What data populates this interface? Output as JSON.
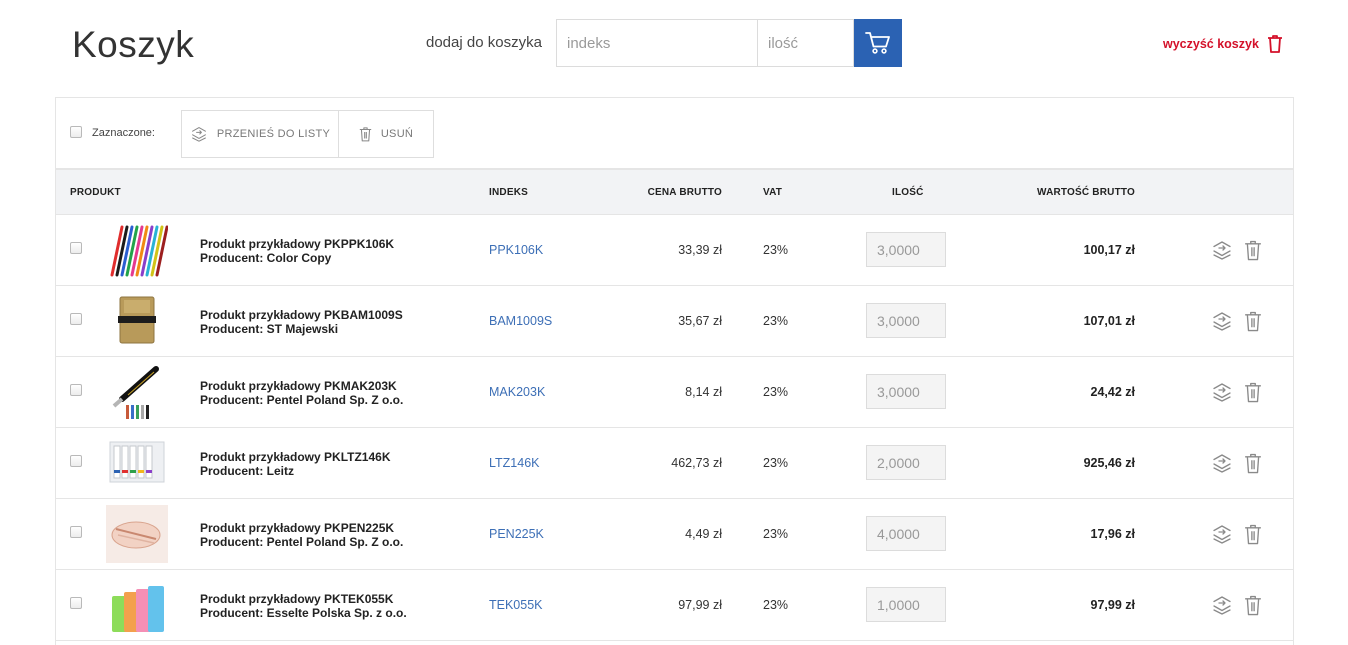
{
  "page": {
    "title": "Koszyk"
  },
  "add_to_cart": {
    "label": "dodaj do koszyka",
    "index_placeholder": "indeks",
    "qty_placeholder": "ilość",
    "button_icon": "cart-icon"
  },
  "clear_cart": {
    "label": "wyczyść koszyk",
    "icon": "trash-icon",
    "color": "#d4112a"
  },
  "bulk": {
    "selected_label": "Zaznaczone:",
    "move_label": "PRZENIEŚ DO LISTY",
    "move_icon": "move-to-list-icon",
    "delete_label": "USUŃ",
    "delete_icon": "trash-icon"
  },
  "columns": {
    "product": "PRODUKT",
    "index": "INDEKS",
    "price": "CENA BRUTTO",
    "vat": "VAT",
    "qty": "ILOŚĆ",
    "value": "WARTOŚĆ BRUTTO"
  },
  "colors": {
    "accent": "#2b62b3",
    "danger": "#d4112a",
    "link": "#3d6fb6"
  },
  "items": [
    {
      "name": "Produkt przykładowy PKPPK106K",
      "producer": "Producent: Color Copy",
      "index": "PPK106K",
      "price": "33,39 zł",
      "vat": "23%",
      "qty": "3,0000",
      "value": "100,17 zł",
      "thumb": "pens"
    },
    {
      "name": "Produkt przykładowy PKBAM1009S",
      "producer": "Producent: ST Majewski",
      "index": "BAM1009S",
      "price": "35,67 zł",
      "vat": "23%",
      "qty": "3,0000",
      "value": "107,01 zł",
      "thumb": "notebook"
    },
    {
      "name": "Produkt przykładowy PKMAK203K",
      "producer": "Producent: Pentel Poland Sp. Z o.o.",
      "index": "MAK203K",
      "price": "8,14 zł",
      "vat": "23%",
      "qty": "3,0000",
      "value": "24,42 zł",
      "thumb": "fountain-pen"
    },
    {
      "name": "Produkt przykładowy PKLTZ146K",
      "producer": "Producent: Leitz",
      "index": "LTZ146K",
      "price": "462,73 zł",
      "vat": "23%",
      "qty": "2,0000",
      "value": "925,46 zł",
      "thumb": "binders"
    },
    {
      "name": "Produkt przykładowy PKPEN225K",
      "producer": "Producent: Pentel Poland Sp. Z o.o.",
      "index": "PEN225K",
      "price": "4,49 zł",
      "vat": "23%",
      "qty": "4,0000",
      "value": "17,96 zł",
      "thumb": "pencil-case"
    },
    {
      "name": "Produkt przykładowy PKTEK055K",
      "producer": "Producent: Esselte Polska Sp. z o.o.",
      "index": "TEK055K",
      "price": "97,99 zł",
      "vat": "23%",
      "qty": "1,0000",
      "value": "97,99 zł",
      "thumb": "folders"
    }
  ]
}
